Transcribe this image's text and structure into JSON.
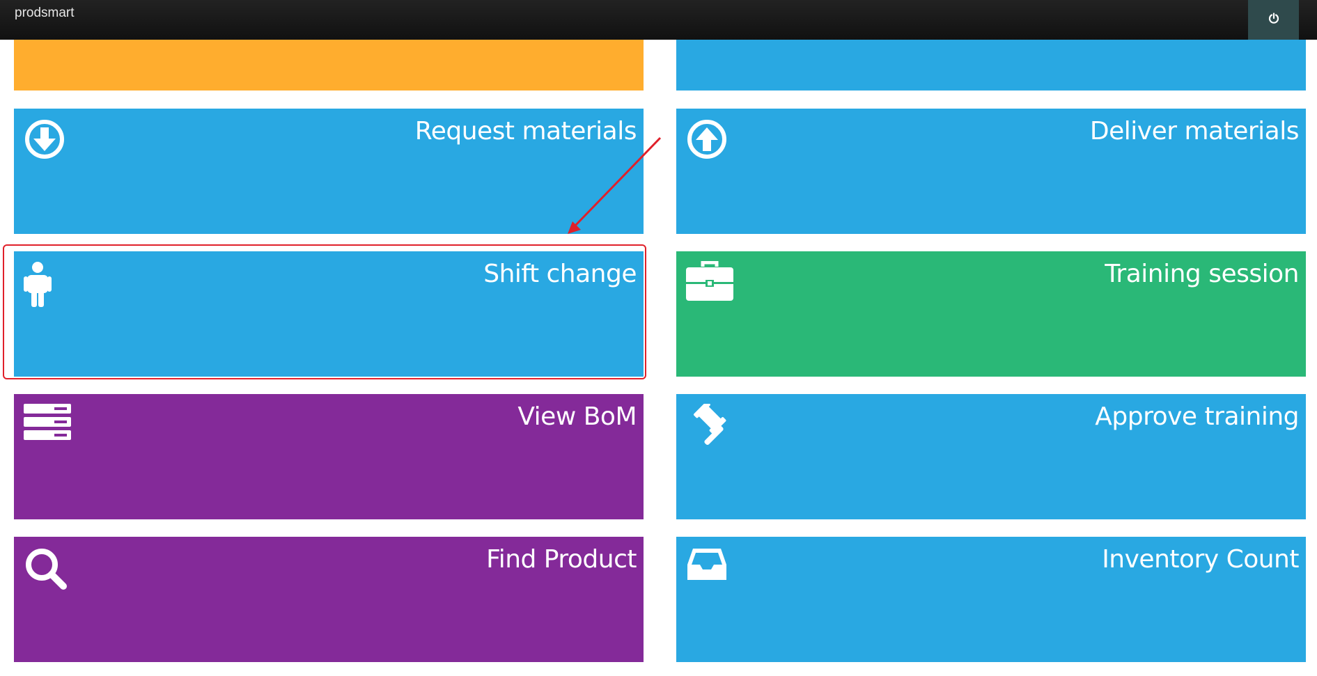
{
  "header": {
    "brand": "prodsmart",
    "power_icon": "power-icon"
  },
  "colors": {
    "topbar": "#111111",
    "power_button": "#2f4a4c",
    "blue": "#29a8e2",
    "orange": "#ffad2e",
    "green": "#2ab877",
    "purple": "#842a99",
    "annotation": "#e0202a"
  },
  "tiles": {
    "top_left": {
      "label": "",
      "color": "orange"
    },
    "top_right": {
      "label": "",
      "color": "blue"
    },
    "request_materials": {
      "label": "Request materials",
      "icon": "arrow-circle-down-icon",
      "color": "blue"
    },
    "deliver_materials": {
      "label": "Deliver materials",
      "icon": "arrow-circle-up-icon",
      "color": "blue"
    },
    "shift_change": {
      "label": "Shift change",
      "icon": "person-icon",
      "color": "blue"
    },
    "training_session": {
      "label": "Training session",
      "icon": "briefcase-icon",
      "color": "green"
    },
    "view_bom": {
      "label": "View BoM",
      "icon": "server-stack-icon",
      "color": "purple"
    },
    "approve_training": {
      "label": "Approve training",
      "icon": "gavel-icon",
      "color": "blue"
    },
    "find_product": {
      "label": "Find Product",
      "icon": "search-icon",
      "color": "purple"
    },
    "inventory_count": {
      "label": "Inventory Count",
      "icon": "inbox-icon",
      "color": "blue"
    }
  }
}
